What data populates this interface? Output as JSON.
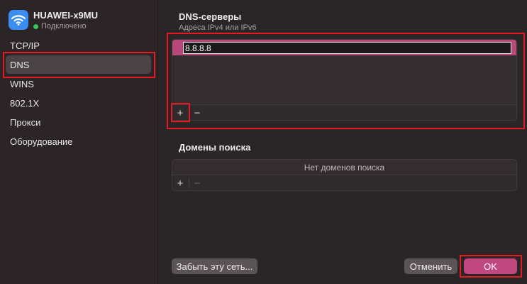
{
  "network": {
    "name": "HUAWEI-x9MU",
    "status": "Подключено",
    "icon": "wifi-icon",
    "status_color": "#34c759"
  },
  "sidebar": {
    "items": [
      {
        "label": "TCP/IP",
        "active": false
      },
      {
        "label": "DNS",
        "active": true
      },
      {
        "label": "WINS",
        "active": false
      },
      {
        "label": "802.1X",
        "active": false
      },
      {
        "label": "Прокси",
        "active": false
      },
      {
        "label": "Оборудование",
        "active": false
      }
    ]
  },
  "dns": {
    "title": "DNS-серверы",
    "subtitle": "Адреса IPv4 или IPv6",
    "servers": [
      "8.8.8.8"
    ],
    "add_label": "+",
    "remove_label": "−"
  },
  "search_domains": {
    "title": "Домены поиска",
    "empty_text": "Нет доменов поиска",
    "add_label": "+",
    "remove_label": "−"
  },
  "footer": {
    "forget_label": "Забыть эту сеть...",
    "cancel_label": "Отменить",
    "ok_label": "OK"
  },
  "colors": {
    "accent": "#c0477f",
    "highlight_box": "#e31b23"
  }
}
